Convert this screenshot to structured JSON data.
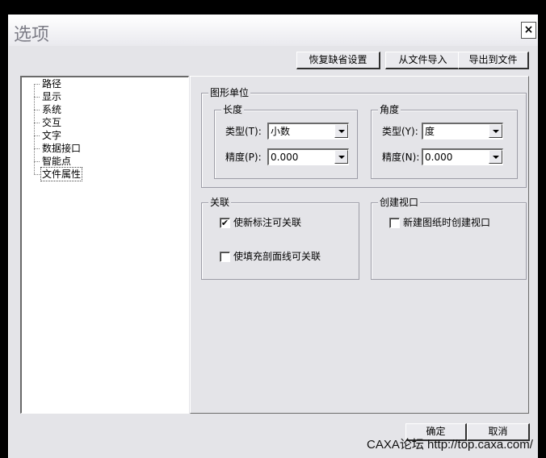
{
  "window": {
    "title": "选项",
    "close_glyph": "×"
  },
  "toolbar": {
    "restore_defaults": "恢复缺省设置",
    "import_from_file": "从文件导入",
    "export_to_file": "导出到文件"
  },
  "tree": {
    "items": [
      {
        "label": "路径"
      },
      {
        "label": "显示"
      },
      {
        "label": "系统"
      },
      {
        "label": "交互"
      },
      {
        "label": "文字"
      },
      {
        "label": "数据接口"
      },
      {
        "label": "智能点"
      },
      {
        "label": "文件属性",
        "selected": true
      }
    ]
  },
  "units": {
    "title": "图形单位",
    "length": {
      "title": "长度",
      "type_label": "类型(T):",
      "type_value": "小数",
      "precision_label": "精度(P):",
      "precision_value": "0.000"
    },
    "angle": {
      "title": "角度",
      "type_label": "类型(Y):",
      "type_value": "度",
      "precision_label": "精度(N):",
      "precision_value": "0.000"
    }
  },
  "association": {
    "title": "关联",
    "option1": {
      "label": "使新标注可关联",
      "checked": true,
      "mark": "✔"
    },
    "option2": {
      "label": "使填充剖面线可关联",
      "checked": false
    }
  },
  "viewport": {
    "title": "创建视口",
    "option1": {
      "label": "新建图纸时创建视口",
      "checked": false
    }
  },
  "footer": {
    "ok": "确定",
    "cancel": "取消"
  },
  "watermark": "CAXA论坛 http://top.caxa.com/"
}
